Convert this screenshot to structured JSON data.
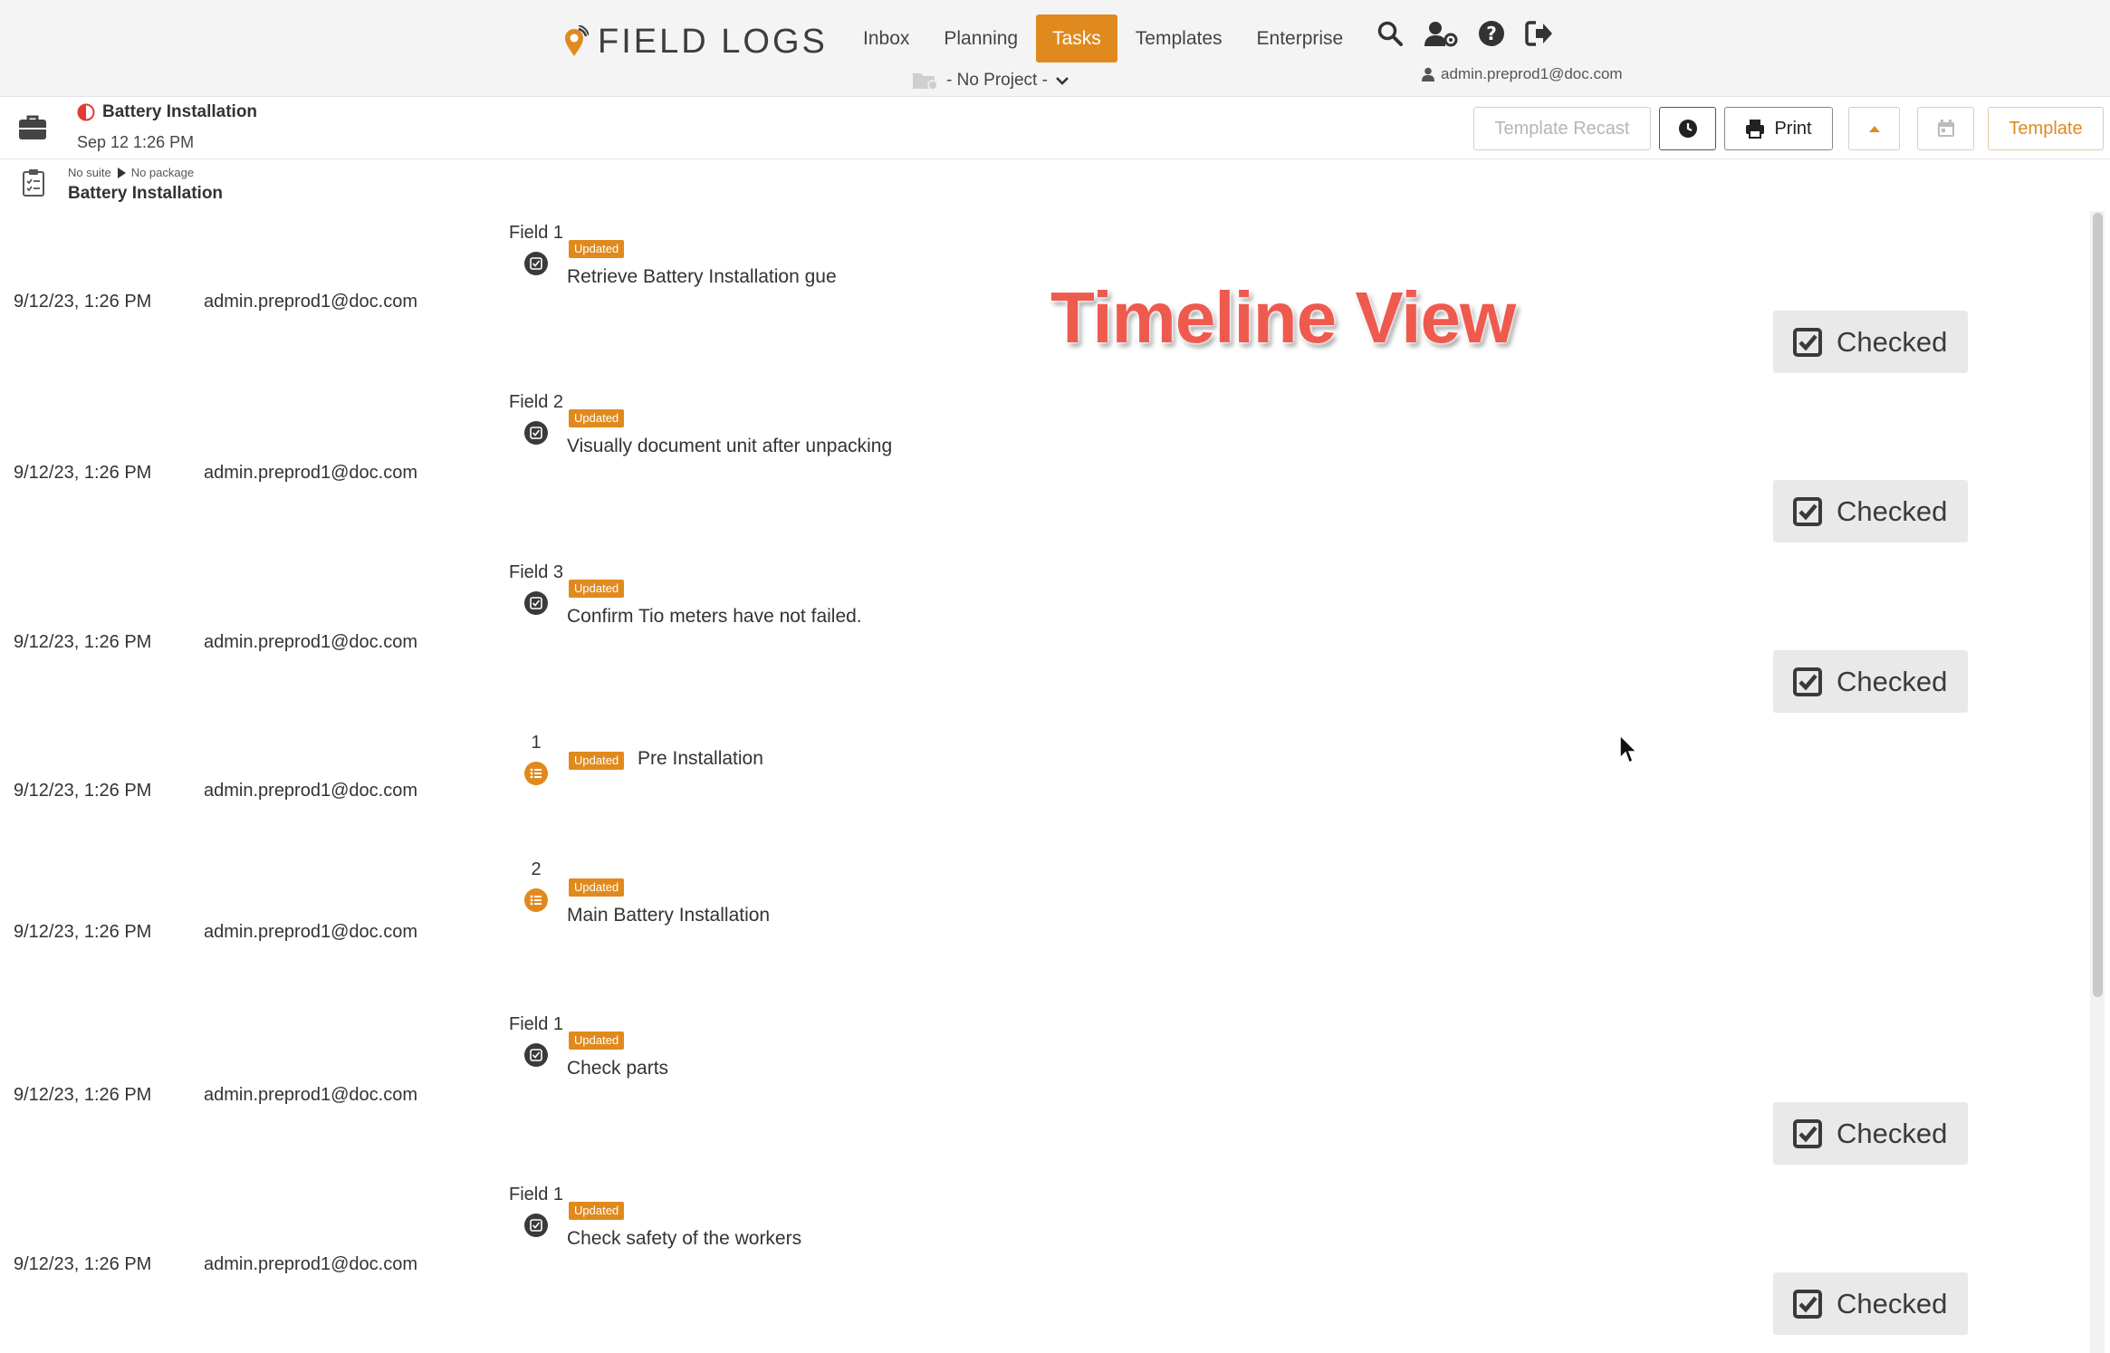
{
  "brand": {
    "name": "FIELD LOGS"
  },
  "nav": {
    "items": [
      "Inbox",
      "Planning",
      "Tasks",
      "Templates",
      "Enterprise"
    ],
    "active": "Tasks"
  },
  "user": {
    "email": "admin.preprod1@doc.com"
  },
  "project": {
    "label": "- No Project -"
  },
  "task": {
    "title": "Battery Installation",
    "date": "Sep 12 1:26 PM"
  },
  "toolbar": {
    "template_recast": "Template Recast",
    "print": "Print",
    "template": "Template"
  },
  "breadcrumb": {
    "suite": "No suite",
    "package": "No package",
    "title": "Battery Installation"
  },
  "overlay": {
    "text": "Timeline View"
  },
  "badge_label": "Updated",
  "checked_label": "Checked",
  "timeline": [
    {
      "time": "9/12/23, 1:26 PM",
      "user": "admin.preprod1@doc.com",
      "field": "Field 1",
      "kind": "field",
      "text": "Retrieve Battery Installation gue",
      "checked": true
    },
    {
      "time": "9/12/23, 1:26 PM",
      "user": "admin.preprod1@doc.com",
      "field": "Field 2",
      "kind": "field",
      "text": "Visually document unit after unpacking",
      "checked": true
    },
    {
      "time": "9/12/23, 1:26 PM",
      "user": "admin.preprod1@doc.com",
      "field": "Field 3",
      "kind": "field",
      "text": "Confirm Tio meters have not failed.",
      "checked": true
    },
    {
      "time": "9/12/23, 1:26 PM",
      "user": "admin.preprod1@doc.com",
      "field": "1",
      "kind": "section-inline",
      "text": "Pre Installation",
      "checked": false
    },
    {
      "time": "9/12/23, 1:26 PM",
      "user": "admin.preprod1@doc.com",
      "field": "2",
      "kind": "section",
      "text": "Main Battery Installation",
      "checked": false
    },
    {
      "time": "9/12/23, 1:26 PM",
      "user": "admin.preprod1@doc.com",
      "field": "Field 1",
      "kind": "field",
      "text": "Check parts",
      "checked": true
    },
    {
      "time": "9/12/23, 1:26 PM",
      "user": "admin.preprod1@doc.com",
      "field": "Field 1",
      "kind": "field",
      "text": "Check safety of the workers",
      "checked": true
    }
  ],
  "colors": {
    "accent": "#e08a1e",
    "overlay": "#ef5a4f"
  }
}
